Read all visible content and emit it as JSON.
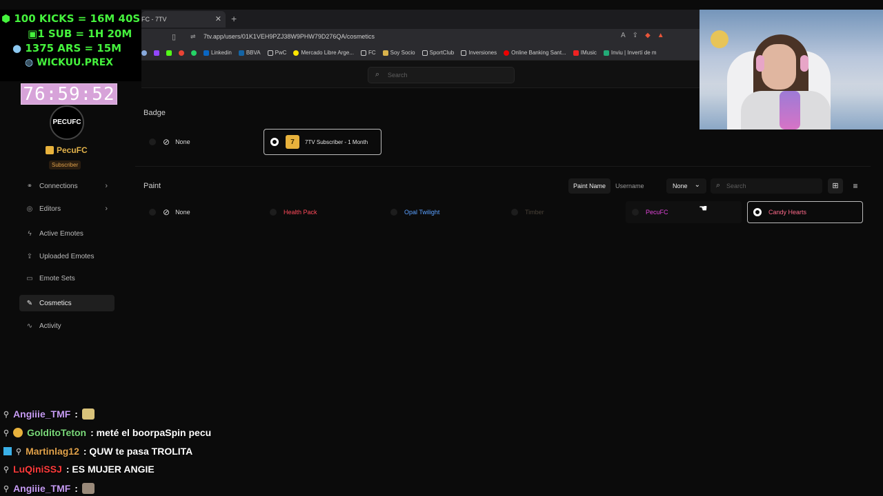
{
  "overlay": {
    "goals": [
      "100 KICKS = 16M 40S",
      "1 SUB = 1H 20M",
      "1375 ARS = 15M",
      "WICKUU.PREX"
    ],
    "timer": "76:59:52"
  },
  "browser": {
    "tab_title": "FC - 7TV",
    "url": "7tv.app/users/01K1VEH9PZJ38W9PHW79D276QA/cosmetics",
    "bookmarks": [
      "Linkedin",
      "BBVA",
      "PwC",
      "Mercado Libre Arge...",
      "FC",
      "Soy Socio",
      "SportClub",
      "Inversiones",
      "Online Banking Sant...",
      "IMusic",
      "Inviu | Invertí de m"
    ]
  },
  "app": {
    "search_placeholder": "Search"
  },
  "profile": {
    "logo_text": "PECUFC",
    "username": "PecuFC",
    "role": "Subscriber"
  },
  "sidebar": {
    "items": [
      {
        "label": "Connections"
      },
      {
        "label": "Editors"
      },
      {
        "label": "Active Emotes"
      },
      {
        "label": "Uploaded Emotes"
      },
      {
        "label": "Emote Sets"
      },
      {
        "label": "Cosmetics"
      },
      {
        "label": "Activity"
      }
    ]
  },
  "badge": {
    "title": "Badge",
    "options": [
      "None",
      "7TV Subscriber - 1 Month"
    ]
  },
  "paint": {
    "title": "Paint",
    "tabs": [
      "Paint Name",
      "Username"
    ],
    "filter": "None",
    "search_placeholder": "Search",
    "options": [
      "None",
      "Health Pack",
      "Opal Twilight",
      "Timber",
      "PecuFC",
      "Candy Hearts"
    ]
  },
  "chat": [
    {
      "user": "Angiiie_TMF",
      "message": ":",
      "color": "#c79cf4"
    },
    {
      "user": "GolditoTeton",
      "message": ": meté el boorpaSpin pecu",
      "color": "#7bd97a"
    },
    {
      "user": "Martinlag12",
      "message": ": QUW te pasa TROLITA",
      "color": "#e0a14a"
    },
    {
      "user": "LuQiniSSJ",
      "message": ": ES MUJER ANGIE",
      "color": "#ff3b3b"
    },
    {
      "user": "Angiiie_TMF",
      "message": ":",
      "color": "#c79cf4"
    }
  ]
}
